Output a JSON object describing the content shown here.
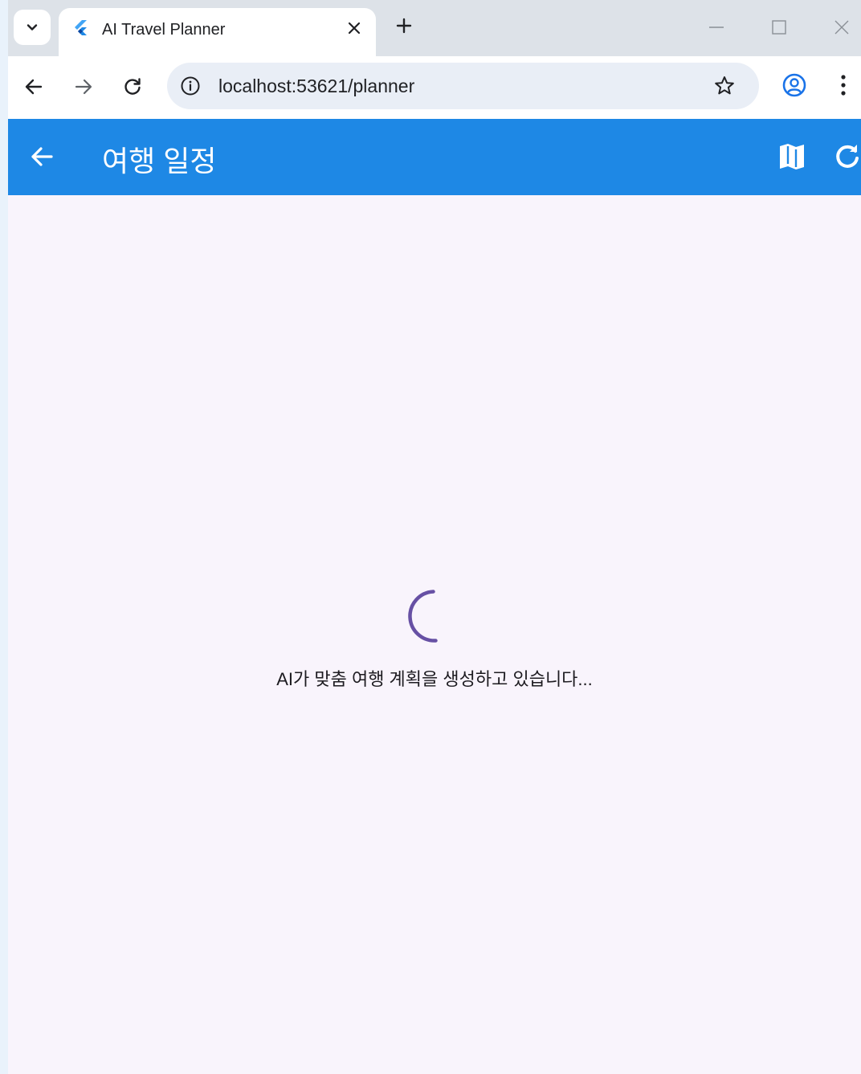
{
  "browser": {
    "tab": {
      "title": "AI Travel Planner"
    },
    "address_bar": {
      "url": "localhost:53621/planner"
    }
  },
  "app": {
    "appbar": {
      "title": "여행 일정"
    },
    "loading": {
      "message": "AI가 맞춤 여행 계획을 생성하고 있습니다..."
    }
  },
  "icons": {
    "tab_search": "chevron-down-icon",
    "favicon": "flutter-logo-icon",
    "tab_close": "close-icon",
    "new_tab": "plus-icon",
    "minimize": "minimize-icon",
    "maximize": "maximize-icon",
    "window_close": "close-icon",
    "back": "arrow-left-icon",
    "forward": "arrow-right-icon",
    "reload": "reload-icon",
    "site_info": "info-icon",
    "bookmark": "star-icon",
    "profile": "account-circle-icon",
    "menu": "more-vertical-icon",
    "appbar_back": "arrow-left-icon",
    "appbar_map": "map-icon",
    "appbar_refresh": "refresh-icon"
  },
  "colors": {
    "appbar": "#1e88e5",
    "page_background": "#f9f4fc",
    "spinner": "#6750a4",
    "profile_icon": "#1a73e8"
  }
}
